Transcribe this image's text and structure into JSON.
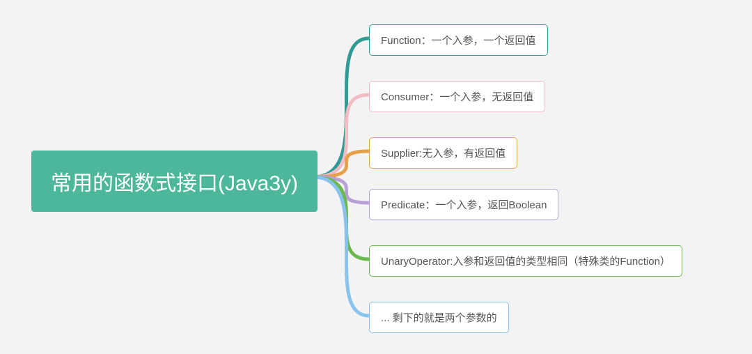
{
  "mindmap": {
    "root": {
      "label": "常用的函数式接口(Java3y)",
      "bg": "#4db79b"
    },
    "children": [
      {
        "label": "Function：一个入参，一个返回值",
        "color": "#2f9b94"
      },
      {
        "label": "Consumer：一个入参，无返回值",
        "color": "#f1bcc4"
      },
      {
        "label": "Supplier:无入参，有返回值",
        "color": "#e6a04a"
      },
      {
        "label": "Predicate：一个入参，返回Boolean",
        "color": "#b7a0d4"
      },
      {
        "label": "UnaryOperator:入参和返回值的类型相同（特殊类的Function）",
        "color": "#6bb84e"
      },
      {
        "label": "... 剩下的就是两个参数的",
        "color": "#88c3ed"
      }
    ]
  }
}
